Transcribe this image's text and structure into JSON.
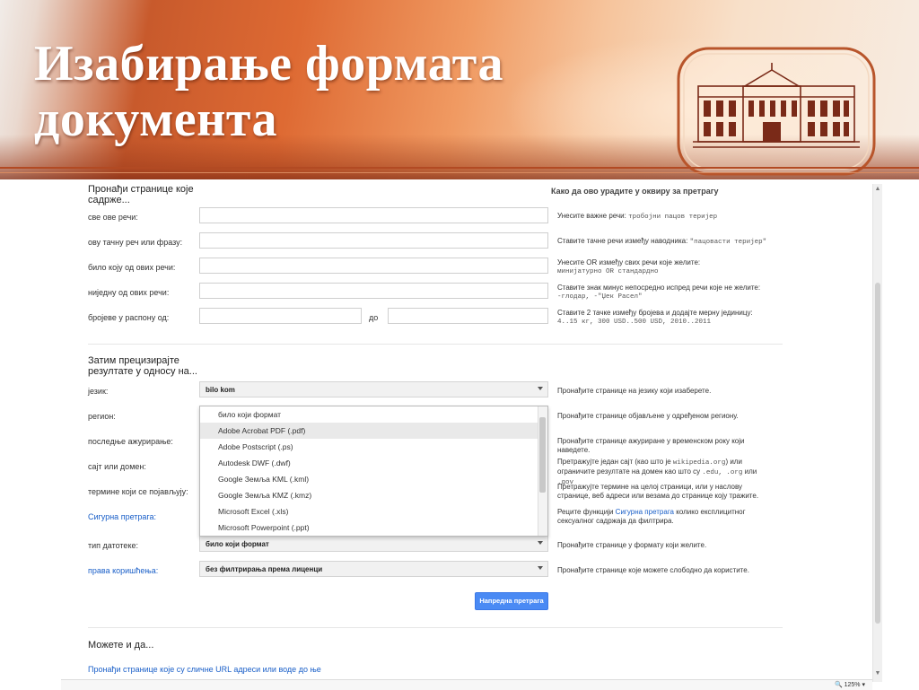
{
  "slide": {
    "title_line1": "Изабирање формата",
    "title_line2": "документа"
  },
  "form": {
    "section1": {
      "title_line1": "Пронађи странице које",
      "title_line2": "садрже...",
      "help_title": "Како да ово урадите у оквиру за претрагу"
    },
    "rows1": [
      {
        "label": "све ове речи:",
        "help": "Унесите важне речи:",
        "example": "тробојни пацов теријер"
      },
      {
        "label": "ову тачну реч или фразу:",
        "help": "Ставите тачне речи између наводника:",
        "example": "\"пацовасти теријер\""
      },
      {
        "label": "било коју од ових речи:",
        "help": "Унесите OR између свих речи које желите:",
        "example": "минијатурно OR стандардно"
      },
      {
        "label": "ниједну од ових речи:",
        "help": "Ставите знак минус непосредно испред речи које не желите:",
        "example": "-глодар, -\"Џек Расел\""
      },
      {
        "label": "бројеве у распону од:",
        "to_label": "до",
        "help": "Ставите 2 тачке између бројева и додајте мерну јединицу:",
        "example": "4..15 кг, 300 USD..500 USD, 2010..2011"
      }
    ],
    "section2": {
      "title_line1": "Затим прецизирајте",
      "title_line2": "резултате у односу на..."
    },
    "rows2": [
      {
        "label": "језик:",
        "value": "bilo kom",
        "help": "Пронађите странице на језику који изаберете."
      },
      {
        "label": "регион:",
        "help": "Пронађите странице објављене у одређеном региону."
      },
      {
        "label": "последње ажурирање:",
        "help": "Пронађите странице ажуриране у временском року који наведете."
      },
      {
        "label": "сајт или домен:",
        "help_a": "Претражујте један сајт (као што је",
        "help_code1": "wikipedia.org",
        "help_b": ") или ограничите резултате на домен као што су",
        "help_code2": ".edu, .org",
        "help_c": "или",
        "help_code3": ".gov"
      },
      {
        "label": "термине који се појављују:",
        "help": "Претражујте термине на целој страници, или у наслову странице, веб адреси или везама до странице коју тражите."
      },
      {
        "label": "Сигурна претрага:",
        "help_a": "Реците функцији",
        "help_link": "Сигурна претрага",
        "help_b": "колико експлицитног сексуалног садржаја да филтрира."
      },
      {
        "label": "тип датотеке:",
        "value": "било који формат",
        "help": "Пронађите странице у формату који желите."
      },
      {
        "label": "права коришћења:",
        "value": "без филтрирања према лиценци",
        "help": "Пронађите странице које можете слободно да користите."
      }
    ],
    "dropdown_options": [
      "било који формат",
      "Adobe Acrobat PDF (.pdf)",
      "Adobe Postscript (.ps)",
      "Autodesk DWF (.dwf)",
      "Google Земља KML (.kml)",
      "Google Земља KMZ (.kmz)",
      "Microsoft Excel (.xls)",
      "Microsoft Powerpoint (.ppt)"
    ],
    "dropdown_highlighted_index": 1,
    "submit_label": "Напредна претрага",
    "section3_title": "Можете и да...",
    "more_link": "Пронађи странице које су сличне URL адреси или воде до ње"
  },
  "status": {
    "zoom": "125%"
  },
  "colors": {
    "accent": "#de6a33",
    "link": "#1a5fc8",
    "button": "#4a8af4"
  }
}
